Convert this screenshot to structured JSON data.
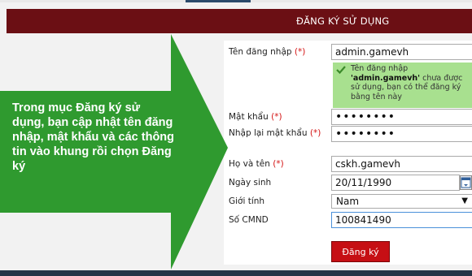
{
  "header": {
    "title": "ĐĂNG KÝ SỬ DỤNG"
  },
  "callout": {
    "text": "Trong mục Đăng ký sử dụng, bạn cập nhật tên đăng nhập, mật khẩu và các thông tin vào khung rồi chọn Đăng ký",
    "color": "#2f9a2f"
  },
  "form": {
    "required_mark": "(*)",
    "username": {
      "label": "Tên đăng nhập",
      "value": "admin.gamevh"
    },
    "availability": {
      "prefix": "Tên đăng nhập",
      "name": "'admin.gamevh'",
      "suffix": "chưa được sử dụng, bạn có thể đăng ký bằng tên này"
    },
    "password": {
      "label": "Mật khẩu",
      "value": "••••••••"
    },
    "password_confirm": {
      "label": "Nhập lại mật khẩu",
      "value": "••••••••"
    },
    "fullname": {
      "label": "Họ và tên",
      "value": "cskh.gamevh"
    },
    "birthday": {
      "label": "Ngày sinh",
      "value": "20/11/1990"
    },
    "gender": {
      "label": "Giới tính",
      "value": "Nam"
    },
    "id_number": {
      "label": "Số CMND",
      "value": "100841490"
    },
    "submit_label": "Đăng ký"
  },
  "colors": {
    "header_bg": "#6b0f14",
    "button_bg": "#c60f14",
    "hint_bg": "#a8e08f"
  }
}
